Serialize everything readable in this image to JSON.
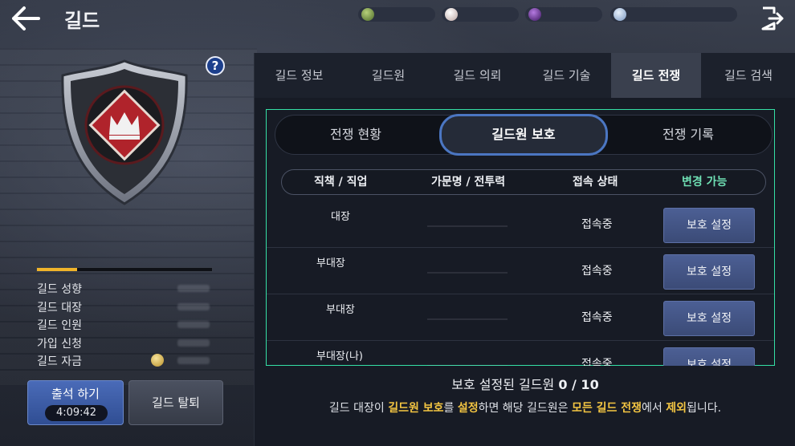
{
  "header": {
    "title": "길드",
    "back_icon": "arrow-left-icon",
    "exit_icon": "exit-door-icon"
  },
  "currencies": [
    {
      "icon": "green-gem-icon",
      "color": "#5f7a3a"
    },
    {
      "icon": "pearl-icon",
      "color": "#d9c9c6"
    },
    {
      "icon": "purple-orb-icon",
      "color": "#5a2a8a"
    },
    {
      "icon": "silver-coin-icon",
      "color": "#8fb0d8"
    }
  ],
  "left": {
    "help_icon_text": "?",
    "emblem_icon": "crown-shield-emblem-icon",
    "exp_progress": 0.23,
    "info_labels": [
      "길드 성향",
      "길드 대장",
      "길드 인원",
      "가입 신청",
      "길드 자금"
    ],
    "attend_label": "출석 하기",
    "attend_timer": "4:09:42",
    "leave_label": "길드 탈퇴"
  },
  "tabs": [
    "길드 정보",
    "길드원",
    "길드 의뢰",
    "길드 기술",
    "길드 전쟁",
    "길드 검색"
  ],
  "active_tab": "길드 전쟁",
  "subtabs": [
    "전쟁 현황",
    "길드원 보호",
    "전쟁 기록"
  ],
  "active_subtab": "길드원 보호",
  "table": {
    "headers": [
      "직책 / 직업",
      "가문명 / 전투력",
      "접속 상태",
      "변경 가능"
    ],
    "rows": [
      {
        "rank": "대장",
        "status": "접속중",
        "button": "보호 설정"
      },
      {
        "rank": "부대장",
        "status": "접속중",
        "button": "보호 설정"
      },
      {
        "rank": "부대장",
        "status": "접속중",
        "button": "보호 설정"
      },
      {
        "rank": "부대장(나)",
        "status": "접속중",
        "button": "보호 설정"
      }
    ]
  },
  "footer": {
    "protect_label": "보호 설정된 길드원",
    "protect_count": "0 / 10",
    "notice_parts": [
      "길드 대장이 ",
      "길드원 보호",
      "를 ",
      "설정",
      "하면 해당 길드원은 ",
      "모든 길드 전쟁",
      "에서 ",
      "제외",
      "됩니다."
    ],
    "highlight_color": "#f3c542"
  }
}
